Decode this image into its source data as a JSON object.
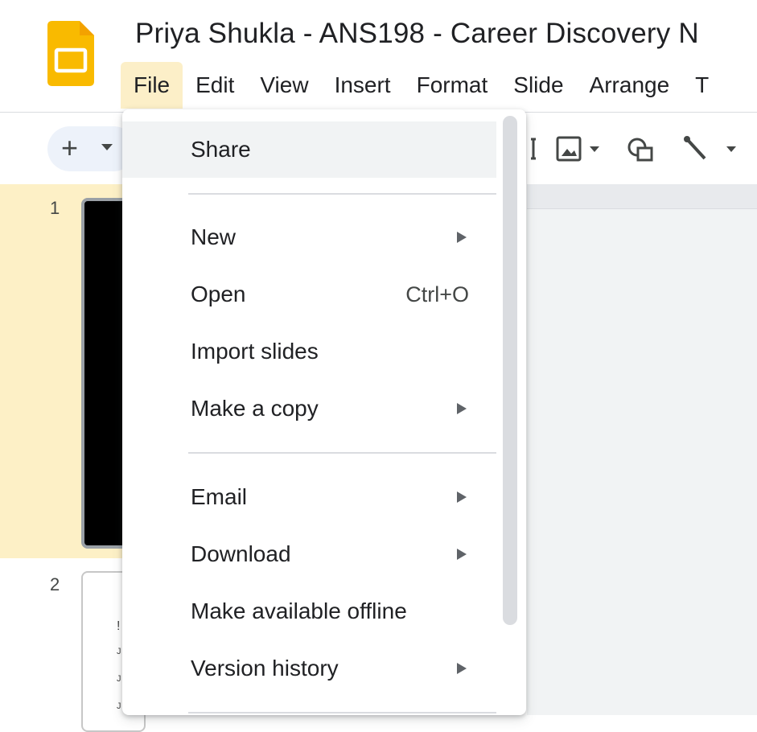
{
  "window": {
    "document_title": "Priya Shukla - ANS198 - Career Discovery N",
    "menubar": [
      "File",
      "Edit",
      "View",
      "Insert",
      "Format",
      "Slide",
      "Arrange",
      "T"
    ]
  },
  "toolbar": {
    "new_slide_symbol": "+",
    "icons": [
      "text-box-icon",
      "image-icon",
      "shape-icon",
      "line-icon"
    ]
  },
  "filmstrip": {
    "slides": [
      {
        "number": "1"
      },
      {
        "number": "2",
        "preview_lines": [
          "!",
          "J",
          "J",
          "J"
        ]
      }
    ]
  },
  "file_menu": {
    "share": "Share",
    "new": "New",
    "open": "Open",
    "open_shortcut": "Ctrl+O",
    "import_slides": "Import slides",
    "make_copy": "Make a copy",
    "email": "Email",
    "download": "Download",
    "make_offline": "Make available offline",
    "version_history": "Version history"
  },
  "colors": {
    "logo": "#f9ba00",
    "active_menu_bg": "#fcefc8",
    "active_slide_bg": "#fdf0c6",
    "menu_hover": "#f1f3f4"
  }
}
